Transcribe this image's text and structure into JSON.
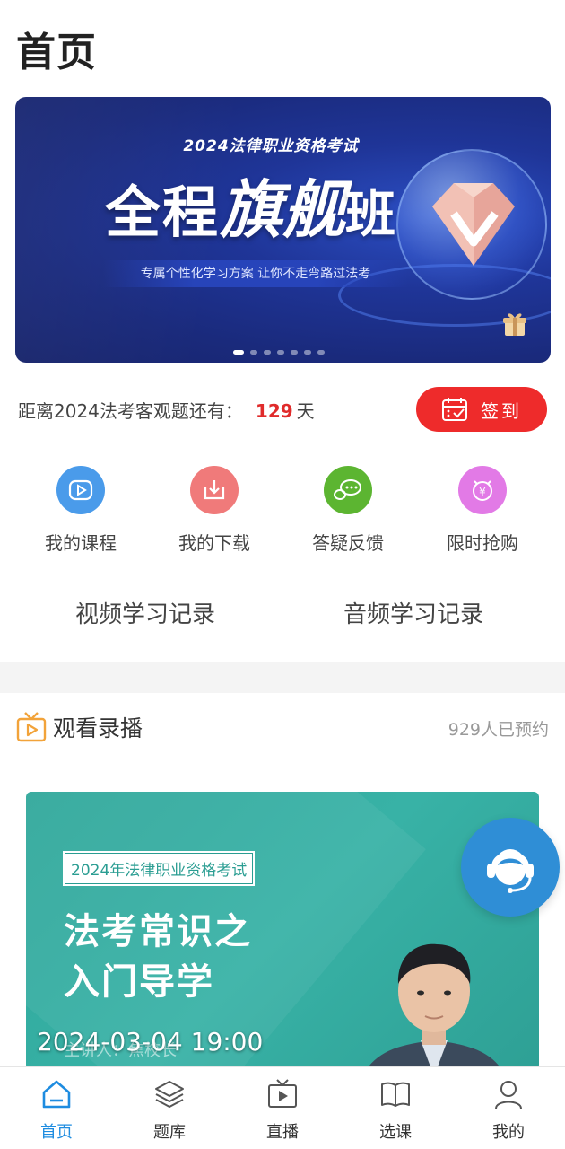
{
  "header": {
    "title": "首页"
  },
  "banner": {
    "supertitle": "2024法律职业资格考试",
    "title_part1": "全程",
    "title_part2": "旗舰",
    "title_part3": "班",
    "subtitle": "专属个性化学习方案 让你不走弯路过法考",
    "page_count": 7,
    "active_page": 1
  },
  "countdown": {
    "label": "距离2024法考客观题还有：",
    "days": "129",
    "unit": "天"
  },
  "signin": {
    "label": "签到",
    "color": "#ee2b2b"
  },
  "quick_actions": [
    {
      "label": "我的课程",
      "icon": "play-icon",
      "color": "#4a9bea"
    },
    {
      "label": "我的下载",
      "icon": "download-icon",
      "color": "#f07a7a"
    },
    {
      "label": "答疑反馈",
      "icon": "chat-icon",
      "color": "#5cb531"
    },
    {
      "label": "限时抢购",
      "icon": "yen-clock-icon",
      "color": "#e27ae6"
    }
  ],
  "records": {
    "video": "视频学习记录",
    "audio": "音频学习记录"
  },
  "live_section": {
    "title": "观看录播",
    "reservations": "929人已预约"
  },
  "video_card": {
    "tag": "2024年法律职业资格考试",
    "title_line1": "法考常识之",
    "title_line2": "入门导学",
    "lecturer": "主讲人：焦校长",
    "datetime": "2024-03-04 19:00"
  },
  "tabbar": {
    "active": "home",
    "accent": "#1e8ce0",
    "items": [
      {
        "key": "home",
        "label": "首页",
        "icon": "home-icon"
      },
      {
        "key": "questions",
        "label": "题库",
        "icon": "layers-icon"
      },
      {
        "key": "live",
        "label": "直播",
        "icon": "tv-play-icon"
      },
      {
        "key": "courses",
        "label": "选课",
        "icon": "book-icon"
      },
      {
        "key": "mine",
        "label": "我的",
        "icon": "user-icon"
      }
    ]
  }
}
